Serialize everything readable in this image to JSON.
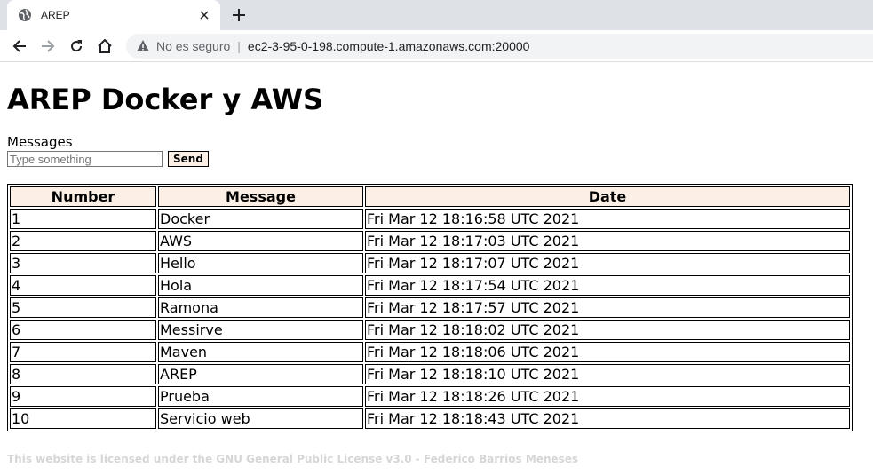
{
  "browser": {
    "tab_title": "AREP",
    "security_label": "No es seguro",
    "separator": "|",
    "url": "ec2-3-95-0-198.compute-1.amazonaws.com:20000"
  },
  "page": {
    "title": "AREP Docker y AWS",
    "form_label": "Messages",
    "input_placeholder": "Type something",
    "send_label": "Send",
    "footer": "This website is licensed under the GNU General Public License v3.0 - Federico Barrios Meneses"
  },
  "table": {
    "headers": [
      "Number",
      "Message",
      "Date"
    ],
    "rows": [
      {
        "number": "1",
        "message": "Docker",
        "date": "Fri Mar 12 18:16:58 UTC 2021"
      },
      {
        "number": "2",
        "message": "AWS",
        "date": "Fri Mar 12 18:17:03 UTC 2021"
      },
      {
        "number": "3",
        "message": "Hello",
        "date": "Fri Mar 12 18:17:07 UTC 2021"
      },
      {
        "number": "4",
        "message": "Hola",
        "date": "Fri Mar 12 18:17:54 UTC 2021"
      },
      {
        "number": "5",
        "message": "Ramona",
        "date": "Fri Mar 12 18:17:57 UTC 2021"
      },
      {
        "number": "6",
        "message": "Messirve",
        "date": "Fri Mar 12 18:18:02 UTC 2021"
      },
      {
        "number": "7",
        "message": "Maven",
        "date": "Fri Mar 12 18:18:06 UTC 2021"
      },
      {
        "number": "8",
        "message": "AREP",
        "date": "Fri Mar 12 18:18:10 UTC 2021"
      },
      {
        "number": "9",
        "message": "Prueba",
        "date": "Fri Mar 12 18:18:26 UTC 2021"
      },
      {
        "number": "10",
        "message": "Servicio web",
        "date": "Fri Mar 12 18:18:43 UTC 2021"
      }
    ]
  },
  "colors": {
    "header_bg": "#fcf0e6",
    "footer_text": "#d6d6d6",
    "chrome_bg": "#dee1e6"
  }
}
